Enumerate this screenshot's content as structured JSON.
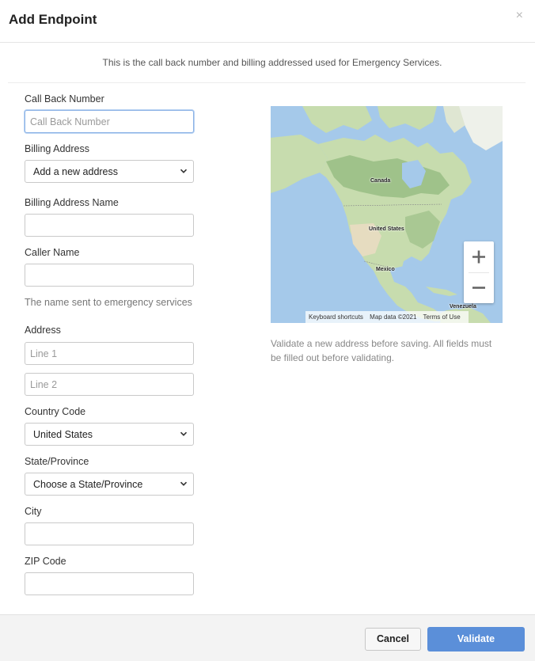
{
  "header": {
    "title": "Add Endpoint",
    "close_glyph": "×"
  },
  "intro": "This is the call back number and billing addressed used for Emergency Services.",
  "form": {
    "callback": {
      "label": "Call Back Number",
      "placeholder": "Call Back Number",
      "value": ""
    },
    "billing_address": {
      "label": "Billing Address",
      "selected": "Add a new address"
    },
    "billing_address_name": {
      "label": "Billing Address Name",
      "value": ""
    },
    "caller_name": {
      "label": "Caller Name",
      "value": "",
      "help": "The name sent to emergency services"
    },
    "address": {
      "label": "Address",
      "line1_placeholder": "Line 1",
      "line2_placeholder": "Line 2"
    },
    "country_code": {
      "label": "Country Code",
      "selected": "United States"
    },
    "state": {
      "label": "State/Province",
      "selected": "Choose a State/Province"
    },
    "city": {
      "label": "City",
      "value": ""
    },
    "zip": {
      "label": "ZIP Code",
      "value": ""
    }
  },
  "map": {
    "labels": {
      "canada": "Canada",
      "united_states": "United States",
      "mexico": "Mexico",
      "venezuela": "Venezuela"
    },
    "zoom_in": "+",
    "zoom_out": "−",
    "attribution": {
      "shortcuts": "Keyboard shortcuts",
      "data": "Map data ©2021",
      "terms": "Terms of Use"
    },
    "colors": {
      "water": "#a5c9ea",
      "land": "#c7dcae",
      "forest": "#9fc28a",
      "desert": "#e6dcc0"
    }
  },
  "map_note": "Validate a new address before saving. All fields must be filled out before validating.",
  "footer": {
    "cancel_label": "Cancel",
    "validate_label": "Validate"
  },
  "colors": {
    "primary": "#5b8fd9",
    "focus_border": "#8cb3e6"
  }
}
